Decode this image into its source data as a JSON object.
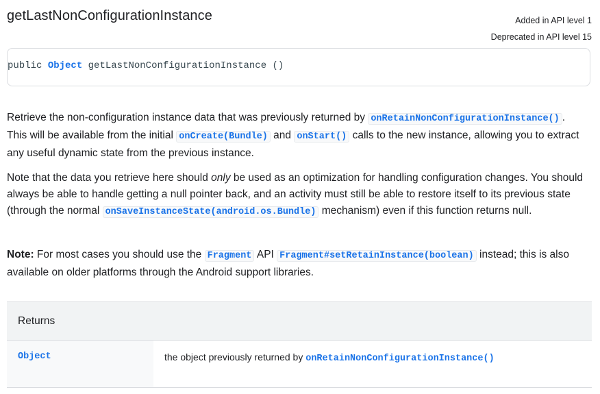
{
  "method": {
    "title": "getLastNonConfigurationInstance",
    "added": "Added in API level 1",
    "deprecated": "Deprecated in API level 15"
  },
  "signature": {
    "modifier": "public",
    "return_type": "Object",
    "name": "getLastNonConfigurationInstance ()"
  },
  "para1": {
    "t1": "Retrieve the non-configuration instance data that was previously returned by ",
    "c1": "onRetainNonConfigurationInstance()",
    "t2": ".",
    "t3": "This will be available from the initial ",
    "c2": "onCreate(Bundle)",
    "t4": " and ",
    "c3": "onStart()",
    "t5": " calls to the new instance, allowing you to extract any useful dynamic state from the previous instance."
  },
  "para2": {
    "t1": "Note that the data you retrieve here should ",
    "em": "only",
    "t2": " be used as an optimization for handling configuration changes. You should always be able to handle getting a null pointer back, and an activity must still be able to restore itself to its previous state (through the normal ",
    "c1": "onSaveInstanceState(android.os.Bundle)",
    "t3": " mechanism) even if this function returns null."
  },
  "para3": {
    "bold": "Note:",
    "t1": " For most cases you should use the ",
    "c1": "Fragment",
    "t2": " API ",
    "c2": "Fragment#setRetainInstance(boolean)",
    "t3": " instead; this is also available on older platforms through the Android support libraries."
  },
  "returns": {
    "header": "Returns",
    "type": "Object",
    "desc": "the object previously returned by ",
    "link": "onRetainNonConfigurationInstance()"
  }
}
